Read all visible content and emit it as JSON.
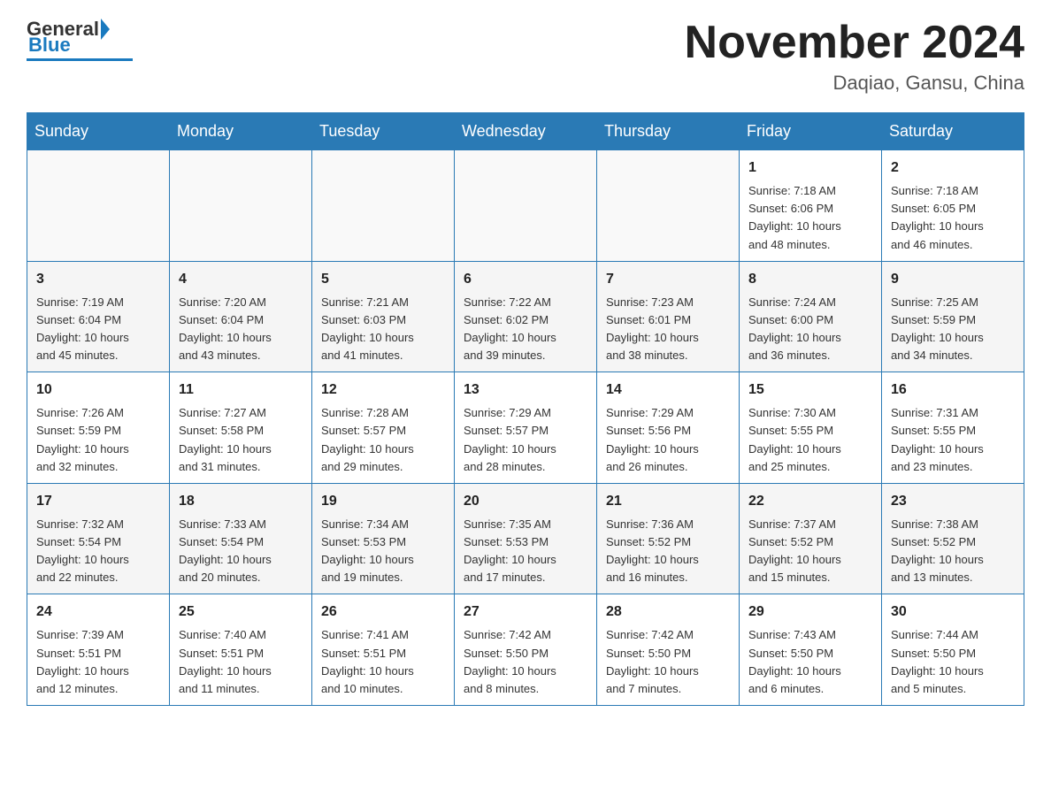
{
  "header": {
    "logo_general": "General",
    "logo_blue": "Blue",
    "month_title": "November 2024",
    "location": "Daqiao, Gansu, China"
  },
  "weekdays": [
    "Sunday",
    "Monday",
    "Tuesday",
    "Wednesday",
    "Thursday",
    "Friday",
    "Saturday"
  ],
  "weeks": [
    [
      {
        "day": "",
        "info": ""
      },
      {
        "day": "",
        "info": ""
      },
      {
        "day": "",
        "info": ""
      },
      {
        "day": "",
        "info": ""
      },
      {
        "day": "",
        "info": ""
      },
      {
        "day": "1",
        "info": "Sunrise: 7:18 AM\nSunset: 6:06 PM\nDaylight: 10 hours\nand 48 minutes."
      },
      {
        "day": "2",
        "info": "Sunrise: 7:18 AM\nSunset: 6:05 PM\nDaylight: 10 hours\nand 46 minutes."
      }
    ],
    [
      {
        "day": "3",
        "info": "Sunrise: 7:19 AM\nSunset: 6:04 PM\nDaylight: 10 hours\nand 45 minutes."
      },
      {
        "day": "4",
        "info": "Sunrise: 7:20 AM\nSunset: 6:04 PM\nDaylight: 10 hours\nand 43 minutes."
      },
      {
        "day": "5",
        "info": "Sunrise: 7:21 AM\nSunset: 6:03 PM\nDaylight: 10 hours\nand 41 minutes."
      },
      {
        "day": "6",
        "info": "Sunrise: 7:22 AM\nSunset: 6:02 PM\nDaylight: 10 hours\nand 39 minutes."
      },
      {
        "day": "7",
        "info": "Sunrise: 7:23 AM\nSunset: 6:01 PM\nDaylight: 10 hours\nand 38 minutes."
      },
      {
        "day": "8",
        "info": "Sunrise: 7:24 AM\nSunset: 6:00 PM\nDaylight: 10 hours\nand 36 minutes."
      },
      {
        "day": "9",
        "info": "Sunrise: 7:25 AM\nSunset: 5:59 PM\nDaylight: 10 hours\nand 34 minutes."
      }
    ],
    [
      {
        "day": "10",
        "info": "Sunrise: 7:26 AM\nSunset: 5:59 PM\nDaylight: 10 hours\nand 32 minutes."
      },
      {
        "day": "11",
        "info": "Sunrise: 7:27 AM\nSunset: 5:58 PM\nDaylight: 10 hours\nand 31 minutes."
      },
      {
        "day": "12",
        "info": "Sunrise: 7:28 AM\nSunset: 5:57 PM\nDaylight: 10 hours\nand 29 minutes."
      },
      {
        "day": "13",
        "info": "Sunrise: 7:29 AM\nSunset: 5:57 PM\nDaylight: 10 hours\nand 28 minutes."
      },
      {
        "day": "14",
        "info": "Sunrise: 7:29 AM\nSunset: 5:56 PM\nDaylight: 10 hours\nand 26 minutes."
      },
      {
        "day": "15",
        "info": "Sunrise: 7:30 AM\nSunset: 5:55 PM\nDaylight: 10 hours\nand 25 minutes."
      },
      {
        "day": "16",
        "info": "Sunrise: 7:31 AM\nSunset: 5:55 PM\nDaylight: 10 hours\nand 23 minutes."
      }
    ],
    [
      {
        "day": "17",
        "info": "Sunrise: 7:32 AM\nSunset: 5:54 PM\nDaylight: 10 hours\nand 22 minutes."
      },
      {
        "day": "18",
        "info": "Sunrise: 7:33 AM\nSunset: 5:54 PM\nDaylight: 10 hours\nand 20 minutes."
      },
      {
        "day": "19",
        "info": "Sunrise: 7:34 AM\nSunset: 5:53 PM\nDaylight: 10 hours\nand 19 minutes."
      },
      {
        "day": "20",
        "info": "Sunrise: 7:35 AM\nSunset: 5:53 PM\nDaylight: 10 hours\nand 17 minutes."
      },
      {
        "day": "21",
        "info": "Sunrise: 7:36 AM\nSunset: 5:52 PM\nDaylight: 10 hours\nand 16 minutes."
      },
      {
        "day": "22",
        "info": "Sunrise: 7:37 AM\nSunset: 5:52 PM\nDaylight: 10 hours\nand 15 minutes."
      },
      {
        "day": "23",
        "info": "Sunrise: 7:38 AM\nSunset: 5:52 PM\nDaylight: 10 hours\nand 13 minutes."
      }
    ],
    [
      {
        "day": "24",
        "info": "Sunrise: 7:39 AM\nSunset: 5:51 PM\nDaylight: 10 hours\nand 12 minutes."
      },
      {
        "day": "25",
        "info": "Sunrise: 7:40 AM\nSunset: 5:51 PM\nDaylight: 10 hours\nand 11 minutes."
      },
      {
        "day": "26",
        "info": "Sunrise: 7:41 AM\nSunset: 5:51 PM\nDaylight: 10 hours\nand 10 minutes."
      },
      {
        "day": "27",
        "info": "Sunrise: 7:42 AM\nSunset: 5:50 PM\nDaylight: 10 hours\nand 8 minutes."
      },
      {
        "day": "28",
        "info": "Sunrise: 7:42 AM\nSunset: 5:50 PM\nDaylight: 10 hours\nand 7 minutes."
      },
      {
        "day": "29",
        "info": "Sunrise: 7:43 AM\nSunset: 5:50 PM\nDaylight: 10 hours\nand 6 minutes."
      },
      {
        "day": "30",
        "info": "Sunrise: 7:44 AM\nSunset: 5:50 PM\nDaylight: 10 hours\nand 5 minutes."
      }
    ]
  ]
}
